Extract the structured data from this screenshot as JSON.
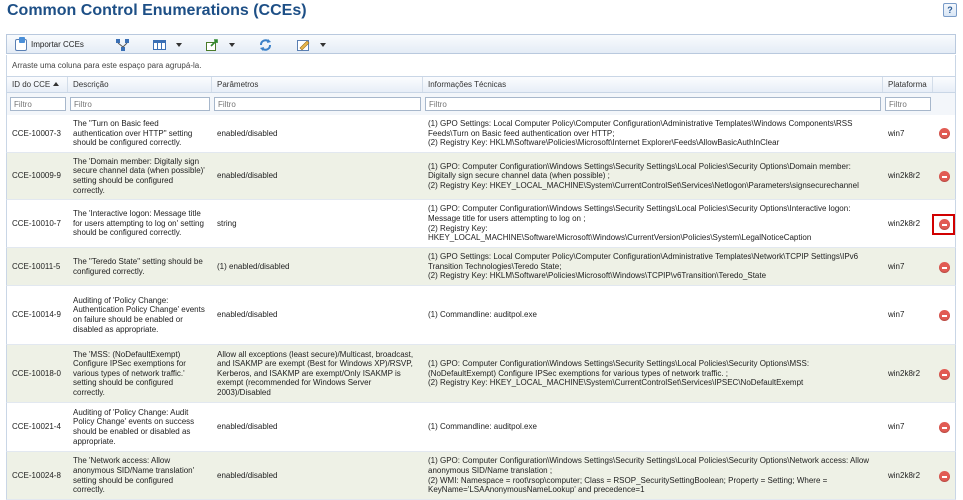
{
  "page": {
    "title": "Common Control Enumerations (CCEs)",
    "help": "?"
  },
  "toolbar": {
    "import_label": "Importar CCEs"
  },
  "group_area": {
    "text": "Arraste uma coluna para este espaço para agrupá-la."
  },
  "columns": {
    "id": "ID do CCE",
    "description": "Descrição",
    "parameters": "Parâmetros",
    "technical": "Informações Técnicas",
    "platform": "Plataforma"
  },
  "filters": {
    "id": "Filtro",
    "description": "Filtro",
    "parameters": "Filtro",
    "technical": "Filtro",
    "platform": "Filtro"
  },
  "rows": [
    {
      "id": "CCE-10007-3",
      "description": "The \"Turn on Basic feed authentication over HTTP\" setting should be configured correctly.",
      "parameters": "enabled/disabled",
      "technical": "(1) GPO Settings: Local Computer Policy\\Computer Configuration\\Administrative Templates\\Windows Components\\RSS Feeds\\Turn on Basic feed authentication over HTTP;\n(2) Registry Key: HKLM\\Software\\Policies\\Microsoft\\Internet Explorer\\Feeds\\AllowBasicAuthInClear",
      "platform": "win7"
    },
    {
      "id": "CCE-10009-9",
      "description": "The 'Domain member: Digitally sign secure channel data (when possible)' setting should be configured correctly.",
      "parameters": "enabled/disabled",
      "technical": "(1) GPO: Computer Configuration\\Windows Settings\\Security Settings\\Local Policies\\Security Options\\Domain member: Digitally sign secure channel data (when possible) ;\n(2) Registry Key: HKEY_LOCAL_MACHINE\\System\\CurrentControlSet\\Services\\Netlogon\\Parameters\\signsecurechannel",
      "platform": "win2k8r2"
    },
    {
      "id": "CCE-10010-7",
      "description": "The 'Interactive logon: Message title for users attempting to log on' setting should be configured correctly.",
      "parameters": "string",
      "technical": "(1) GPO: Computer Configuration\\Windows Settings\\Security Settings\\Local Policies\\Security Options\\Interactive logon: Message title for users attempting to log on ;\n(2) Registry Key:\nHKEY_LOCAL_MACHINE\\Software\\Microsoft\\Windows\\CurrentVersion\\Policies\\System\\LegalNoticeCaption",
      "platform": "win2k8r2"
    },
    {
      "id": "CCE-10011-5",
      "description": "The \"Teredo State\" setting should be configured correctly.",
      "parameters": "(1) enabled/disabled",
      "technical": "(1) GPO Settings: Local Computer Policy\\Computer Configuration\\Administrative Templates\\Network\\TCPIP Settings\\IPv6 Transition Technologies\\Teredo State;\n(2) Registry Key: HKLM\\Software\\Policies\\Microsoft\\Windows\\TCPIP\\v6Transition\\Teredo_State",
      "platform": "win7"
    },
    {
      "id": "CCE-10014-9",
      "description": "Auditing of 'Policy Change: Authentication Policy Change' events on failure should be enabled or disabled as appropriate.",
      "parameters": "enabled/disabled",
      "technical": "(1) Commandline: auditpol.exe",
      "platform": "win7"
    },
    {
      "id": "CCE-10018-0",
      "description": "The 'MSS: (NoDefaultExempt) Configure IPSec exemptions for various types of network traffic.' setting should be configured correctly.",
      "parameters": "Allow all exceptions (least secure)/Multicast, broadcast, and ISAKMP are exempt (Best for Windows XP)/RSVP, Kerberos, and ISAKMP are exempt/Only ISAKMP is exempt (recommended for Windows Server 2003)/Disabled",
      "technical": "(1) GPO: Computer Configuration\\Windows Settings\\Security Settings\\Local Policies\\Security Options\\MSS: (NoDefaultExempt) Configure IPSec exemptions for various types of network traffic. ;\n(2) Registry Key: HKEY_LOCAL_MACHINE\\System\\CurrentControlSet\\Services\\IPSEC\\NoDefaultExempt",
      "platform": "win2k8r2"
    },
    {
      "id": "CCE-10021-4",
      "description": "Auditing of 'Policy Change: Audit Policy Change' events on success should be enabled or disabled as appropriate.",
      "parameters": "enabled/disabled",
      "technical": "(1) Commandline: auditpol.exe",
      "platform": "win7"
    },
    {
      "id": "CCE-10024-8",
      "description": "The 'Network access: Allow anonymous SID/Name translation' setting should be configured correctly.",
      "parameters": "enabled/disabled",
      "technical": "(1) GPO: Computer Configuration\\Windows Settings\\Security Settings\\Local Policies\\Security Options\\Network access: Allow anonymous SID/Name translation ;\n(2) WMI: Namespace = root\\rsop\\computer; Class = RSOP_SecuritySettingBoolean; Property = Setting; Where = KeyName='LSAAnonymousNameLookup' and precedence=1",
      "platform": "win2k8r2"
    }
  ],
  "colors": {
    "title": "#1d4f86",
    "delete": "#e15b53",
    "highlight": "#d10000",
    "alt_row": "#eef1e6"
  }
}
